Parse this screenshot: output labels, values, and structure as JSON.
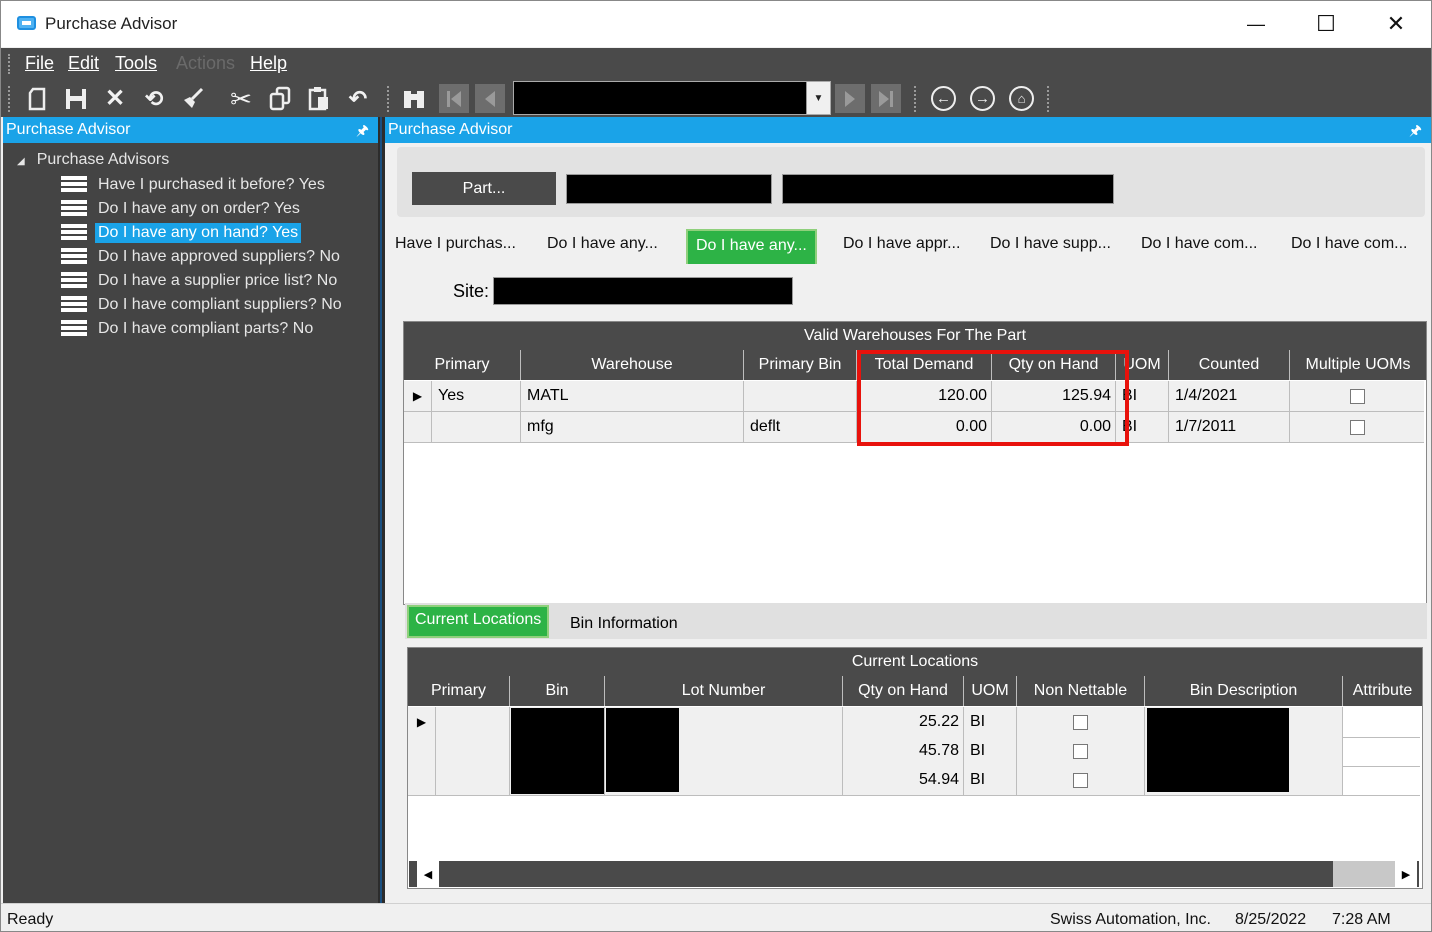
{
  "window": {
    "title": "Purchase Advisor",
    "minimize": "—",
    "maximize": "☐",
    "close": "✕"
  },
  "menu": [
    {
      "label": "File"
    },
    {
      "label": "Edit"
    },
    {
      "label": "Tools"
    },
    {
      "label": "Actions",
      "disabled": true
    },
    {
      "label": "Help"
    }
  ],
  "left_pane": {
    "title": "Purchase Advisor",
    "root": "Purchase Advisors",
    "items": [
      {
        "label": "Have I purchased it before? Yes"
      },
      {
        "label": "Do I have any on order? Yes"
      },
      {
        "label": "Do I have any on hand? Yes",
        "selected": true
      },
      {
        "label": "Do I have approved suppliers? No"
      },
      {
        "label": "Do I have a supplier price list? No"
      },
      {
        "label": "Do I have compliant suppliers? No"
      },
      {
        "label": "Do I have compliant parts? No"
      }
    ]
  },
  "right_pane": {
    "title": "Purchase Advisor",
    "part_button": "Part...",
    "tabs": [
      {
        "label": "Have I purchas..."
      },
      {
        "label": "Do I have any..."
      },
      {
        "label": "Do I have any...",
        "active": true
      },
      {
        "label": "Do I have appr..."
      },
      {
        "label": "Do I have supp..."
      },
      {
        "label": "Do I have com..."
      },
      {
        "label": "Do I have com..."
      }
    ],
    "site_label": "Site:"
  },
  "warehouses": {
    "caption": "Valid Warehouses For The Part",
    "columns": [
      "Primary",
      "Warehouse",
      "Primary Bin",
      "Total Demand",
      "Qty on Hand",
      "UOM",
      "Counted",
      "Multiple UOMs"
    ],
    "rows": [
      {
        "primary": "Yes",
        "warehouse": "MATL",
        "primary_bin": "",
        "total_demand": "120.00",
        "qty_on_hand": "125.94",
        "uom": "BI",
        "counted": "1/4/2021",
        "multiple_uoms": false
      },
      {
        "primary": "",
        "warehouse": "mfg",
        "primary_bin": "deflt",
        "total_demand": "0.00",
        "qty_on_hand": "0.00",
        "uom": "BI",
        "counted": "1/7/2011",
        "multiple_uoms": false
      }
    ]
  },
  "sub_tabs": [
    {
      "label": "Current Locations",
      "active": true
    },
    {
      "label": "Bin Information"
    }
  ],
  "locations": {
    "caption": "Current Locations",
    "columns": [
      "Primary",
      "Bin",
      "Lot Number",
      "Qty on Hand",
      "UOM",
      "Non Nettable",
      "Bin Description",
      "Attribute"
    ],
    "rows": [
      {
        "qty_on_hand": "25.22",
        "uom": "BI",
        "non_nettable": false
      },
      {
        "qty_on_hand": "45.78",
        "uom": "BI",
        "non_nettable": false
      },
      {
        "qty_on_hand": "54.94",
        "uom": "BI",
        "non_nettable": false
      }
    ]
  },
  "status": {
    "left": "Ready",
    "company": "Swiss Automation, Inc.",
    "date": "8/25/2022",
    "time": "7:28 AM"
  }
}
